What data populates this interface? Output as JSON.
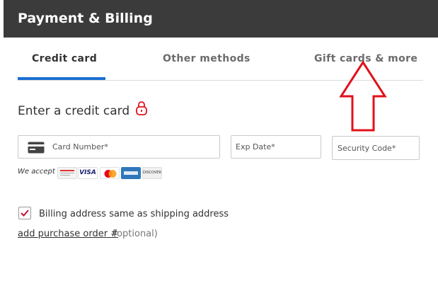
{
  "header": {
    "title": "Payment & Billing"
  },
  "tabs": [
    {
      "label": "Credit card",
      "active": true
    },
    {
      "label": "Other methods",
      "active": false
    },
    {
      "label": "Gift cards & more",
      "active": false
    }
  ],
  "section": {
    "title": "Enter a credit card"
  },
  "fields": {
    "card_number_placeholder": "Card Number*",
    "exp_date_placeholder": "Exp Date*",
    "security_code_placeholder": "Security Code*"
  },
  "accept": {
    "label": "We accept",
    "logos": [
      "store-card-icon",
      "visa-icon",
      "mastercard-icon",
      "amex-icon",
      "discover-icon"
    ],
    "visa_text": "VISA",
    "discover_text": "DISCOVER"
  },
  "billing": {
    "checked": true,
    "label": "Billing address same as shipping address"
  },
  "purchase_order": {
    "link": "add purchase order #",
    "optional": "(optional)"
  },
  "colors": {
    "header_bg": "#3b3b3b",
    "tab_accent": "#1d6fd1",
    "annotation_red": "#e0121b"
  }
}
